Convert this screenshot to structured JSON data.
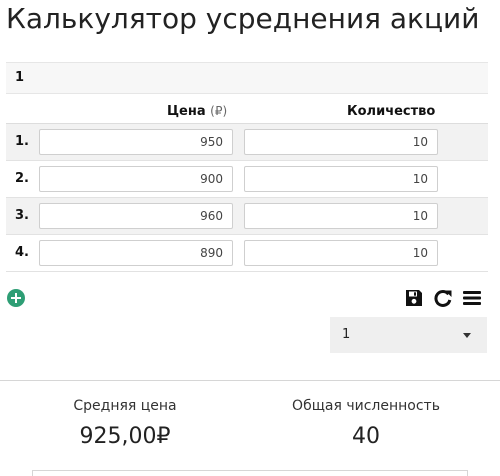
{
  "title": "Калькулятор усреднения акций",
  "portfolio_name": "1",
  "table": {
    "price_header": "Цена",
    "price_unit": "(₽)",
    "qty_header": "Количество",
    "rows": [
      {
        "index": "1.",
        "price": "950",
        "qty": "10"
      },
      {
        "index": "2.",
        "price": "900",
        "qty": "10"
      },
      {
        "index": "3.",
        "price": "960",
        "qty": "10"
      },
      {
        "index": "4.",
        "price": "890",
        "qty": "10"
      }
    ]
  },
  "icons": {
    "add": "plus-circle-icon",
    "save": "floppy-disk-icon",
    "reload": "reload-icon",
    "menu": "hamburger-menu-icon"
  },
  "saved_select": {
    "value": "1"
  },
  "summary": {
    "avg_label": "Средняя цена",
    "avg_value": "925,00₽",
    "total_label": "Общая численность",
    "total_value": "40"
  },
  "colors": {
    "accent": "#2e9e75"
  }
}
